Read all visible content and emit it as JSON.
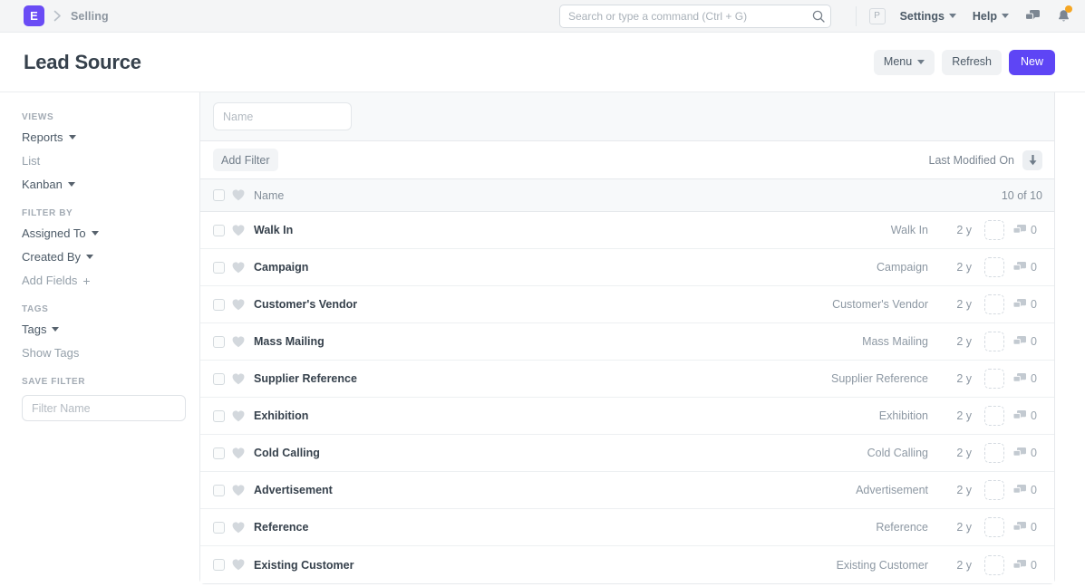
{
  "navbar": {
    "logo_letter": "E",
    "breadcrumb": "Selling",
    "search": {
      "placeholder": "Search or type a command (Ctrl + G)",
      "value": ""
    },
    "avatar_letter": "P",
    "settings_label": "Settings",
    "help_label": "Help",
    "icons": {
      "search": "search-icon",
      "chat": "chat-icon",
      "bell": "bell-icon"
    }
  },
  "page": {
    "title": "Lead Source",
    "actions": {
      "menu_label": "Menu",
      "refresh_label": "Refresh",
      "new_label": "New"
    }
  },
  "sidebar": {
    "views": {
      "heading": "VIEWS",
      "items": [
        {
          "label": "Reports",
          "caret": true,
          "muted": false
        },
        {
          "label": "List",
          "caret": false,
          "muted": true
        },
        {
          "label": "Kanban",
          "caret": true,
          "muted": false
        }
      ]
    },
    "filter_by": {
      "heading": "FILTER BY",
      "items": [
        {
          "label": "Assigned To",
          "caret": true,
          "muted": false
        },
        {
          "label": "Created By",
          "caret": true,
          "muted": false
        },
        {
          "label": "Add Fields",
          "caret": false,
          "muted": true,
          "plus": true
        }
      ]
    },
    "tags": {
      "heading": "TAGS",
      "items": [
        {
          "label": "Tags",
          "caret": true,
          "muted": false
        },
        {
          "label": "Show Tags",
          "caret": false,
          "muted": true
        }
      ]
    },
    "save_filter": {
      "heading": "SAVE FILTER",
      "input_placeholder": "Filter Name",
      "input_value": ""
    }
  },
  "list": {
    "name_filter": {
      "placeholder": "Name",
      "value": ""
    },
    "add_filter_label": "Add Filter",
    "sort": {
      "field_label": "Last Modified On",
      "direction": "descending",
      "direction_icon": "arrow-down-icon"
    },
    "header": {
      "name_column": "Name",
      "count_label": "10 of 10"
    },
    "rows": [
      {
        "name": "Walk In",
        "subject": "Walk In",
        "age": "2 y",
        "comments": "0"
      },
      {
        "name": "Campaign",
        "subject": "Campaign",
        "age": "2 y",
        "comments": "0"
      },
      {
        "name": "Customer's Vendor",
        "subject": "Customer's Vendor",
        "age": "2 y",
        "comments": "0"
      },
      {
        "name": "Mass Mailing",
        "subject": "Mass Mailing",
        "age": "2 y",
        "comments": "0"
      },
      {
        "name": "Supplier Reference",
        "subject": "Supplier Reference",
        "age": "2 y",
        "comments": "0"
      },
      {
        "name": "Exhibition",
        "subject": "Exhibition",
        "age": "2 y",
        "comments": "0"
      },
      {
        "name": "Cold Calling",
        "subject": "Cold Calling",
        "age": "2 y",
        "comments": "0"
      },
      {
        "name": "Advertisement",
        "subject": "Advertisement",
        "age": "2 y",
        "comments": "0"
      },
      {
        "name": "Reference",
        "subject": "Reference",
        "age": "2 y",
        "comments": "0"
      },
      {
        "name": "Existing Customer",
        "subject": "Existing Customer",
        "age": "2 y",
        "comments": "0"
      }
    ]
  },
  "colors": {
    "brand_purple": "#6a4cf5",
    "primary_button": "#5e45f5",
    "notification_dot": "#f5a623",
    "text_dark": "#36414c",
    "text_muted": "#8d98a3"
  }
}
